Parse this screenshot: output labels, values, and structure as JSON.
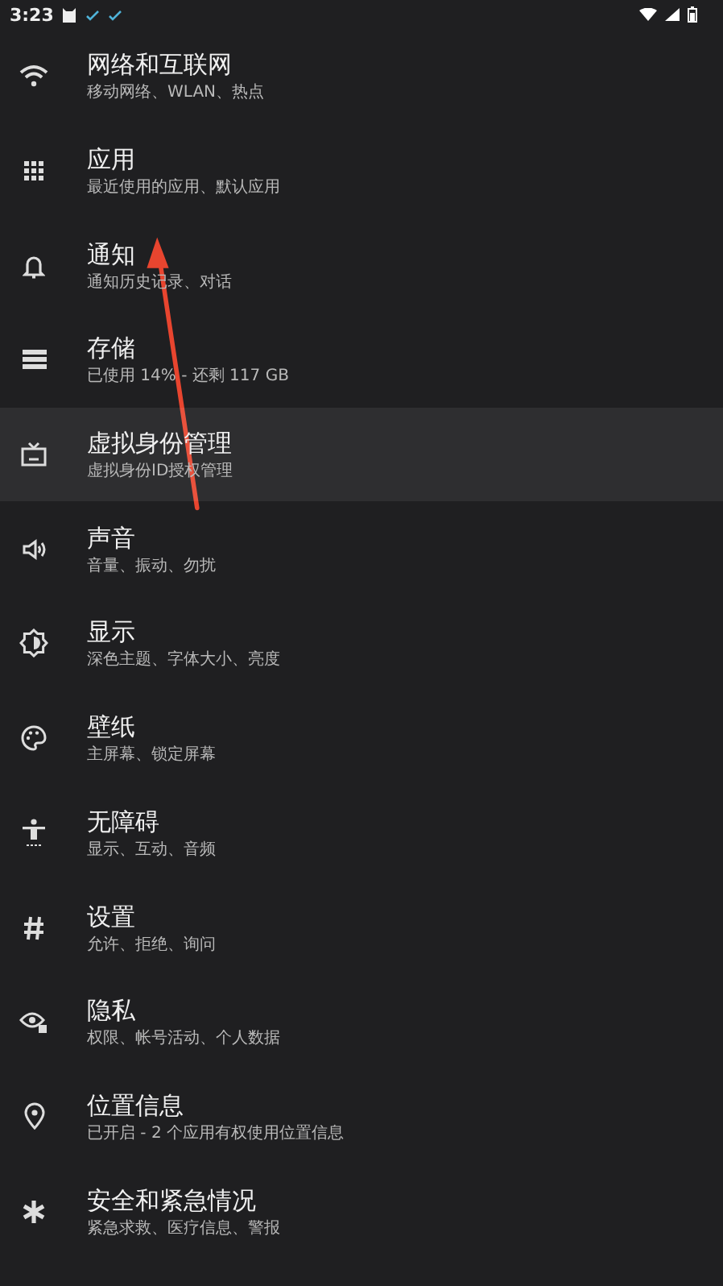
{
  "status_bar": {
    "time": "3:23"
  },
  "settings": [
    {
      "kind": "wifi",
      "title": "网络和互联网",
      "subtitle": "移动网络、WLAN、热点",
      "selected": false
    },
    {
      "kind": "apps",
      "title": "应用",
      "subtitle": "最近使用的应用、默认应用",
      "selected": false
    },
    {
      "kind": "bell",
      "title": "通知",
      "subtitle": "通知历史记录、对话",
      "selected": false
    },
    {
      "kind": "storage",
      "title": "存储",
      "subtitle": "已使用 14% - 还剩 117 GB",
      "selected": false
    },
    {
      "kind": "tv",
      "title": "虚拟身份管理",
      "subtitle": "虚拟身份ID授权管理",
      "selected": true
    },
    {
      "kind": "speaker",
      "title": "声音",
      "subtitle": "音量、振动、勿扰",
      "selected": false
    },
    {
      "kind": "brightness",
      "title": "显示",
      "subtitle": "深色主题、字体大小、亮度",
      "selected": false
    },
    {
      "kind": "palette",
      "title": "壁纸",
      "subtitle": "主屏幕、锁定屏幕",
      "selected": false
    },
    {
      "kind": "accessibility",
      "title": "无障碍",
      "subtitle": "显示、互动、音频",
      "selected": false
    },
    {
      "kind": "hash",
      "title": "设置",
      "subtitle": "允许、拒绝、询问",
      "selected": false
    },
    {
      "kind": "privacy",
      "title": "隐私",
      "subtitle": "权限、帐号活动、个人数据",
      "selected": false
    },
    {
      "kind": "location",
      "title": "位置信息",
      "subtitle": "已开启 - 2 个应用有权使用位置信息",
      "selected": false
    },
    {
      "kind": "asterisk",
      "title": "安全和紧急情况",
      "subtitle": "紧急求救、医疗信息、警报",
      "selected": false
    }
  ],
  "annotation_arrow": true
}
